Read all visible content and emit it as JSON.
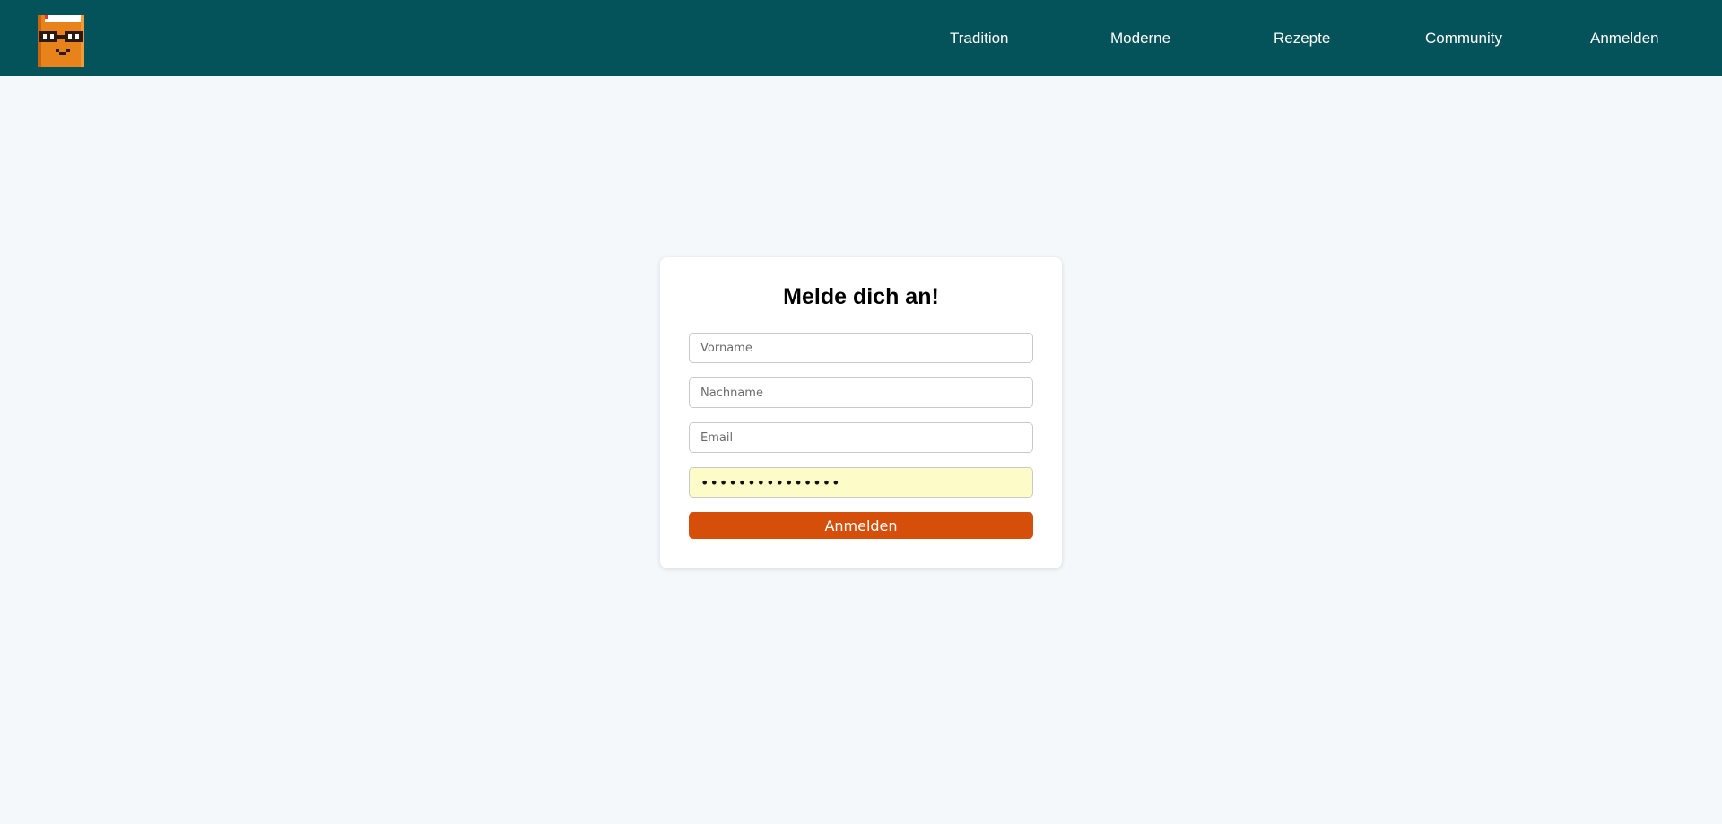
{
  "header": {
    "logo_icon": "pixel-book-mascot-icon",
    "nav": [
      {
        "label": "Tradition"
      },
      {
        "label": "Moderne"
      },
      {
        "label": "Rezepte"
      },
      {
        "label": "Community"
      },
      {
        "label": "Anmelden"
      }
    ],
    "background_color": "#04525a"
  },
  "login_card": {
    "title": "Melde dich an!",
    "fields": {
      "vorname": {
        "placeholder": "Vorname",
        "value": ""
      },
      "nachname": {
        "placeholder": "Nachname",
        "value": ""
      },
      "email": {
        "placeholder": "Email",
        "value": ""
      },
      "password": {
        "value": "•••••••••••••••"
      }
    },
    "submit_label": "Anmelden",
    "submit_color": "#d64f0a",
    "autofill_color": "#fdfbc8"
  },
  "page": {
    "background_color": "#f4f8fb"
  }
}
